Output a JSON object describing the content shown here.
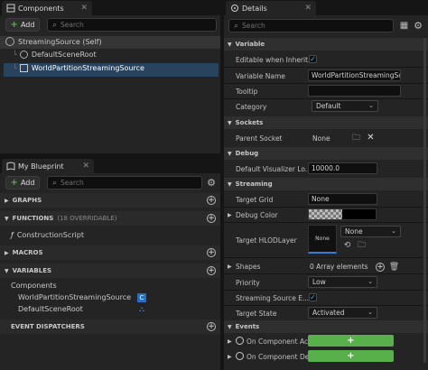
{
  "components": {
    "tab_title": "Components",
    "add_label": "Add",
    "search_placeholder": "Search",
    "items": [
      {
        "label": "StreamingSource (Self)"
      },
      {
        "label": "DefaultSceneRoot"
      },
      {
        "label": "WorldPartitionStreamingSource"
      }
    ]
  },
  "blueprint": {
    "tab_title": "My Blueprint",
    "add_label": "Add",
    "search_placeholder": "Search",
    "sections": {
      "graphs": "GRAPHS",
      "functions": "FUNCTIONS",
      "functions_note": "(18 OVERRIDABLE)",
      "construction_script": "ConstructionScript",
      "macros": "MACROS",
      "variables": "VARIABLES",
      "components_group": "Components",
      "var_item_1": "WorldPartitionStreamingSource",
      "var_item_2": "DefaultSceneRoot",
      "event_dispatchers": "EVENT DISPATCHERS"
    }
  },
  "details": {
    "tab_title": "Details",
    "search_placeholder": "Search",
    "variable": {
      "header": "Variable",
      "editable_label": "Editable when Inherit...",
      "name_label": "Variable Name",
      "name_value": "WorldPartitionStreamingSour",
      "tooltip_label": "Tooltip",
      "category_label": "Category",
      "category_value": "Default"
    },
    "sockets": {
      "header": "Sockets",
      "parent_label": "Parent Socket",
      "parent_value": "None"
    },
    "debug": {
      "header": "Debug",
      "viz_label": "Default Visualizer Lo...",
      "viz_value": "10000.0"
    },
    "streaming": {
      "header": "Streaming",
      "target_grid_label": "Target Grid",
      "target_grid_value": "None",
      "debug_color_label": "Debug Color",
      "hlod_label": "Target HLODLayer",
      "hlod_thumb": "None",
      "hlod_value": "None",
      "shapes_label": "Shapes",
      "shapes_value": "0 Array elements",
      "priority_label": "Priority",
      "priority_value": "Low",
      "streaming_src_label": "Streaming Source E...",
      "target_state_label": "Target State",
      "target_state_value": "Activated"
    },
    "events": {
      "header": "Events",
      "ev1_label": "On Component Ac",
      "ev2_label": "On Component De"
    }
  }
}
